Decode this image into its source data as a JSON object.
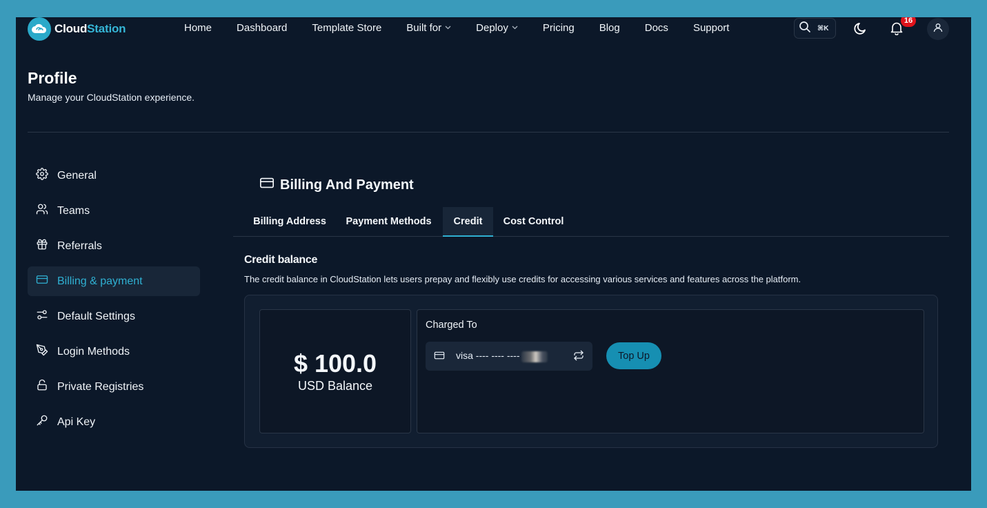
{
  "nav": {
    "logo": {
      "part1": "Cloud",
      "part2": "Station"
    },
    "links": [
      {
        "label": "Home",
        "dropdown": false
      },
      {
        "label": "Dashboard",
        "dropdown": false
      },
      {
        "label": "Template Store",
        "dropdown": false
      },
      {
        "label": "Built for",
        "dropdown": true
      },
      {
        "label": "Deploy",
        "dropdown": true
      },
      {
        "label": "Pricing",
        "dropdown": false
      },
      {
        "label": "Blog",
        "dropdown": false
      },
      {
        "label": "Docs",
        "dropdown": false
      },
      {
        "label": "Support",
        "dropdown": false
      }
    ],
    "search_shortcut": "⌘K",
    "notification_count": "16"
  },
  "header": {
    "title": "Profile",
    "subtitle": "Manage your CloudStation experience."
  },
  "sidebar": {
    "items": [
      {
        "label": "General",
        "icon": "gear-icon",
        "active": false
      },
      {
        "label": "Teams",
        "icon": "users-icon",
        "active": false
      },
      {
        "label": "Referrals",
        "icon": "gift-icon",
        "active": false
      },
      {
        "label": "Billing & payment",
        "icon": "credit-card-icon",
        "active": true
      },
      {
        "label": "Default Settings",
        "icon": "sliders-icon",
        "active": false
      },
      {
        "label": "Login Methods",
        "icon": "pen-tool-icon",
        "active": false
      },
      {
        "label": "Private Registries",
        "icon": "unlock-icon",
        "active": false
      },
      {
        "label": "Api Key",
        "icon": "key-icon",
        "active": false
      }
    ]
  },
  "main": {
    "section_title": "Billing And Payment",
    "tabs": [
      {
        "label": "Billing Address",
        "active": false
      },
      {
        "label": "Payment Methods",
        "active": false
      },
      {
        "label": "Credit",
        "active": true
      },
      {
        "label": "Cost Control",
        "active": false
      }
    ],
    "credit": {
      "title": "Credit balance",
      "description": "The credit balance in CloudStation lets users prepay and flexibly use credits for accessing various services and features across the platform.",
      "amount": "$ 100.0",
      "amount_label": "USD Balance",
      "charged_to_label": "Charged To",
      "card_text": "visa ---- ---- ----",
      "top_up_label": "Top Up"
    }
  },
  "colors": {
    "accent": "#2fb0d2",
    "background": "#0c1829",
    "frame": "#3a9bbb",
    "badge": "#e0131b",
    "button": "#168fb2"
  }
}
